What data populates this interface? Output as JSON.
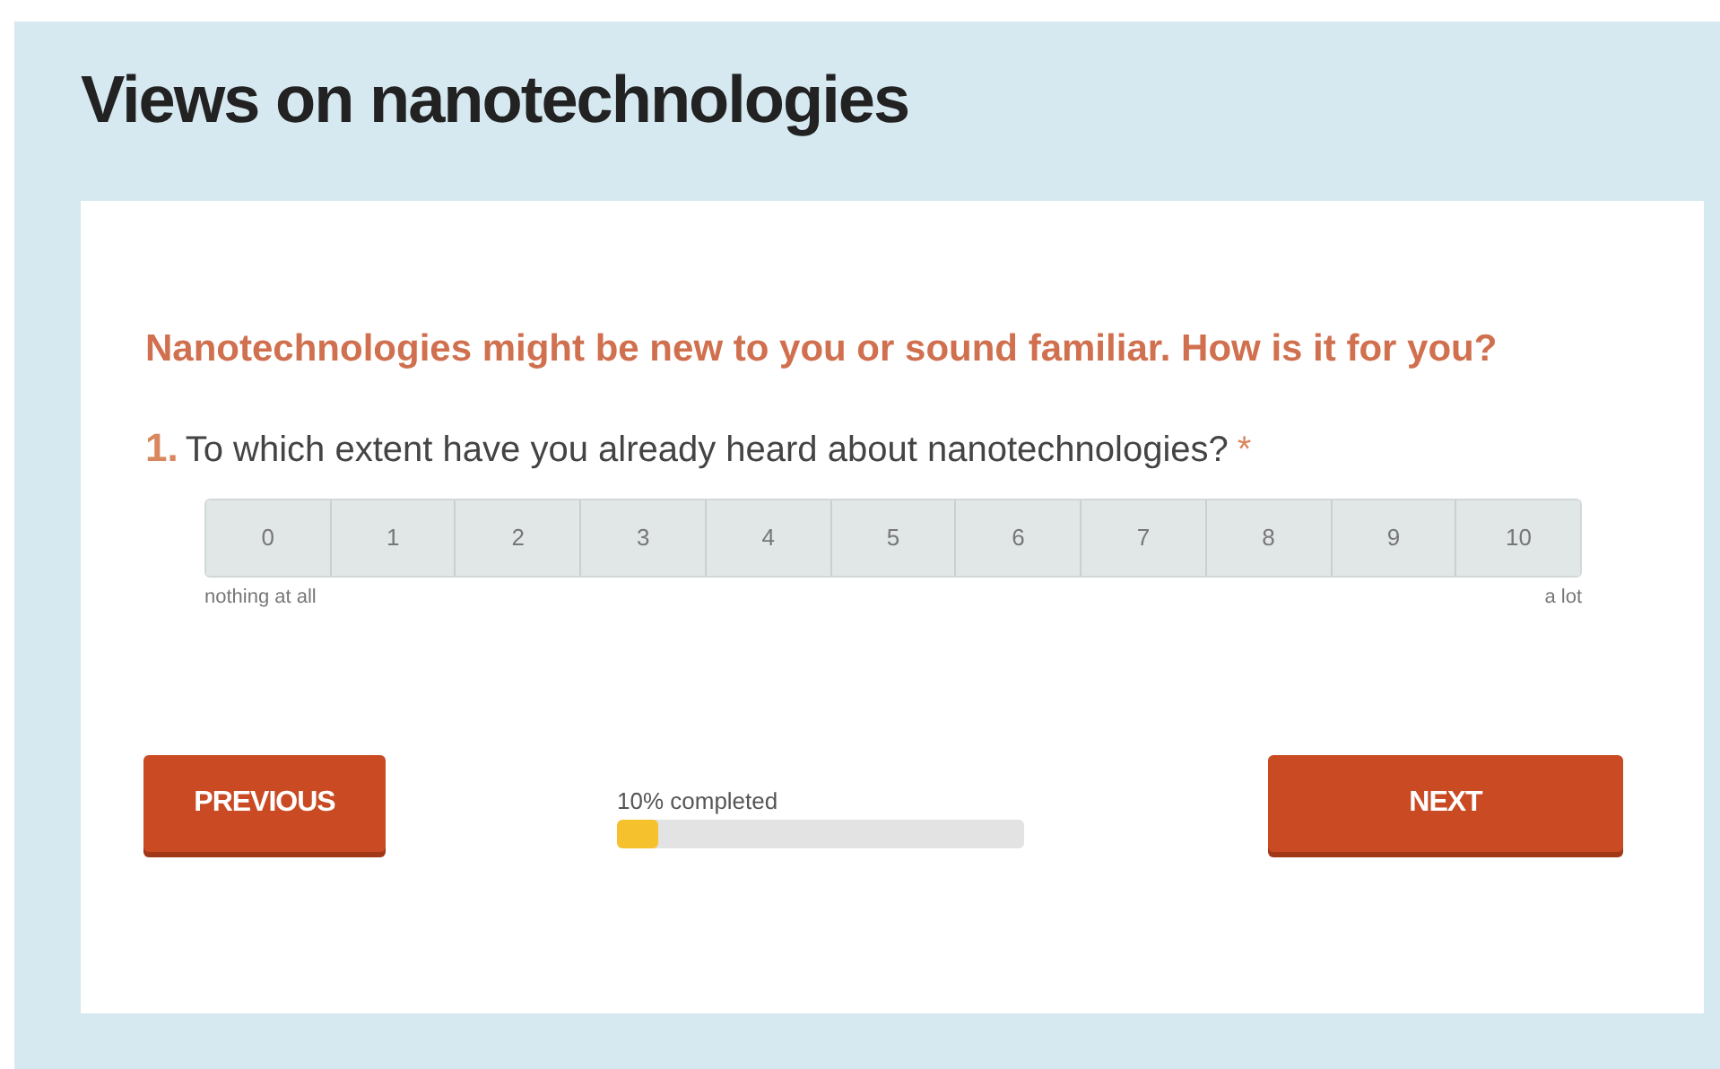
{
  "title": "Views on nanotechnologies",
  "section_heading": "Nanotechnologies might be new to you or sound familiar. How is it for you?",
  "question": {
    "number": "1.",
    "text": "To which extent have you already heard about nanotechnologies?",
    "required_mark": "*",
    "scale": [
      {
        "label": "0",
        "selected": false
      },
      {
        "label": "1",
        "selected": false
      },
      {
        "label": "2",
        "selected": false
      },
      {
        "label": "3",
        "selected": false
      },
      {
        "label": "4",
        "selected": false
      },
      {
        "label": "5",
        "selected": false
      },
      {
        "label": "6",
        "selected": false
      },
      {
        "label": "7",
        "selected": false
      },
      {
        "label": "8",
        "selected": false
      },
      {
        "label": "9",
        "selected": false
      },
      {
        "label": "10",
        "selected": false
      }
    ],
    "min_label": "nothing at all",
    "max_label": "a lot"
  },
  "previous_button": "PREVIOUS",
  "progress": {
    "label": "10% completed",
    "level": 0.1
  },
  "next_button": "NEXT"
}
